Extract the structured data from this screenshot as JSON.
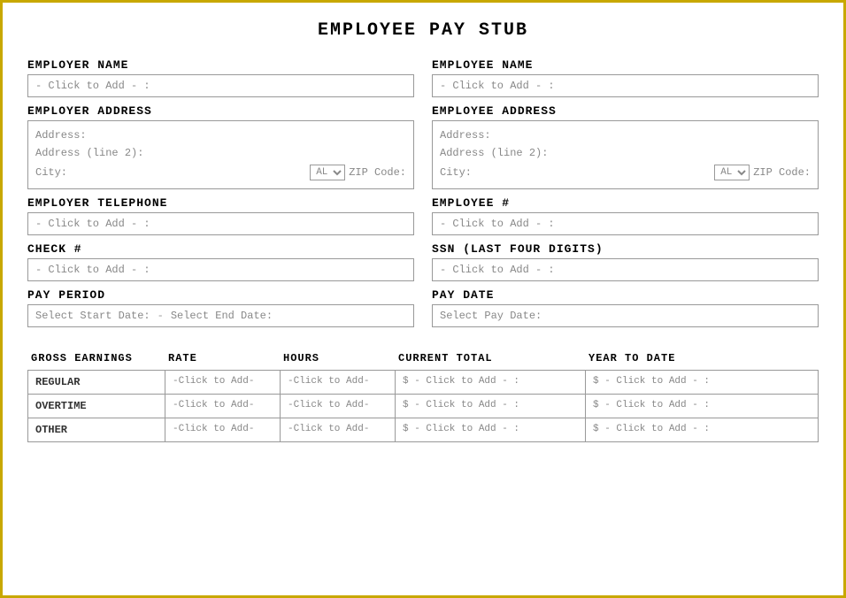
{
  "title": "EMPLOYEE PAY STUB",
  "employer": {
    "name_label": "EMPLOYER NAME",
    "name_placeholder": "- Click to Add - :",
    "address_label": "EMPLOYER ADDRESS",
    "address_line1": "Address:",
    "address_line2": "Address (line 2):",
    "city_label": "City:",
    "state_default": "AL",
    "zip_label": "ZIP Code:",
    "telephone_label": "EMPLOYER TELEPHONE",
    "telephone_placeholder": "- Click to Add - :",
    "check_label": "CHECK #",
    "check_placeholder": "- Click to Add - :",
    "pay_period_label": "PAY PERIOD",
    "pay_period_start": "Select Start Date:",
    "pay_period_dash": "-",
    "pay_period_end": "Select End Date:"
  },
  "employee": {
    "name_label": "EMPLOYEE NAME",
    "name_placeholder": "- Click to Add - :",
    "address_label": "EMPLOYEE ADDRESS",
    "address_line1": "Address:",
    "address_line2": "Address (line 2):",
    "city_label": "City:",
    "state_default": "AL",
    "zip_label": "ZIP Code:",
    "number_label": "EMPLOYEE #",
    "number_placeholder": "- Click to Add - :",
    "ssn_label": "SSN (LAST FOUR DIGITS)",
    "ssn_placeholder": "- Click to Add - :",
    "pay_date_label": "PAY DATE",
    "pay_date_placeholder": "Select Pay Date:"
  },
  "earnings": {
    "headers": [
      "GROSS EARNINGS",
      "RATE",
      "HOURS",
      "CURRENT TOTAL",
      "YEAR TO DATE"
    ],
    "rows": [
      {
        "label": "REGULAR",
        "rate": "-Click to Add-",
        "hours": "-Click to Add-",
        "current": "$ - Click to Add - :",
        "ytd": "$ - Click to Add - :"
      },
      {
        "label": "OVERTIME",
        "rate": "-Click to Add-",
        "hours": "-Click to Add-",
        "current": "$ - Click to Add - :",
        "ytd": "$ - Click to Add - :"
      },
      {
        "label": "OTHER",
        "rate": "-Click to Add-",
        "hours": "-Click to Add-",
        "current": "$ - Click to Add - :",
        "ytd": "$ - Click to Add - :"
      }
    ]
  }
}
